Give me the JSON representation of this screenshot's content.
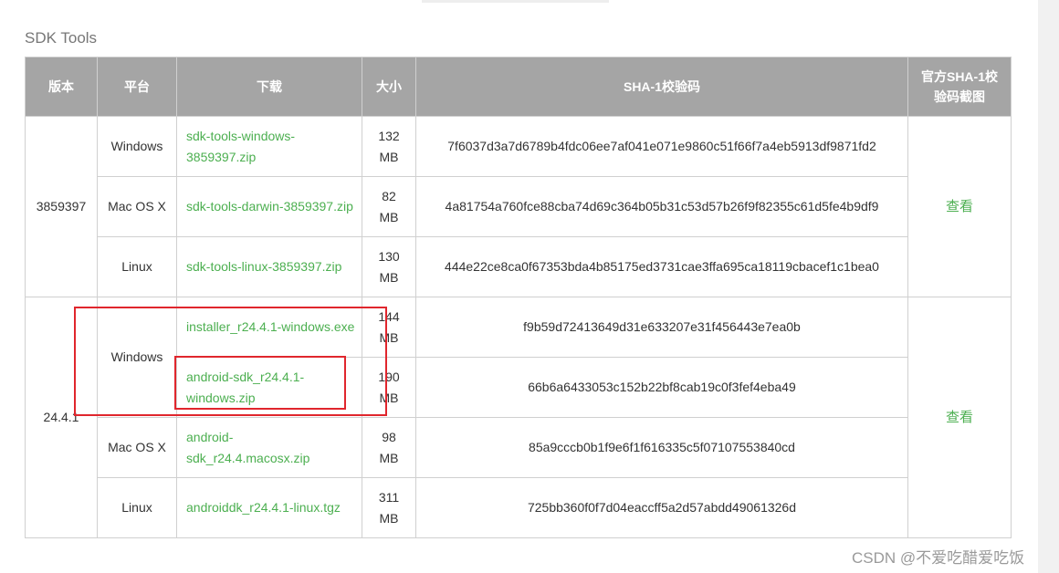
{
  "section_title": "SDK Tools",
  "headers": {
    "version": "版本",
    "platform": "平台",
    "download": "下载",
    "size": "大小",
    "sha1": "SHA-1校验码",
    "screenshot": "官方SHA-1校验码截图"
  },
  "groups": [
    {
      "version": "3859397",
      "view_label": "查看",
      "rows": [
        {
          "platform": "Windows",
          "file": "sdk-tools-windows-3859397.zip",
          "size": "132 MB",
          "sha1": "7f6037d3a7d6789b4fdc06ee7af041e071e9860c51f66f7a4eb5913df9871fd2"
        },
        {
          "platform": "Mac OS X",
          "file": "sdk-tools-darwin-3859397.zip",
          "size": "82 MB",
          "sha1": "4a81754a760fce88cba74d69c364b05b31c53d57b26f9f82355c61d5fe4b9df9"
        },
        {
          "platform": "Linux",
          "file": "sdk-tools-linux-3859397.zip",
          "size": "130 MB",
          "sha1": "444e22ce8ca0f67353bda4b85175ed3731cae3ffa695ca18119cbacef1c1bea0"
        }
      ]
    },
    {
      "version": "24.4.1",
      "view_label": "查看",
      "windows_platform": "Windows",
      "rows": [
        {
          "file": "installer_r24.4.1-windows.exe",
          "size": "144 MB",
          "sha1": "f9b59d72413649d31e633207e31f456443e7ea0b"
        },
        {
          "file": "android-sdk_r24.4.1-windows.zip",
          "size": "190 MB",
          "sha1": "66b6a6433053c152b22bf8cab19c0f3fef4eba49"
        },
        {
          "platform": "Mac OS X",
          "file": "android-sdk_r24.4.macosx.zip",
          "size": "98 MB",
          "sha1": "85a9cccb0b1f9e6f1f616335c5f07107553840cd"
        },
        {
          "platform": "Linux",
          "file": "androiddk_r24.4.1-linux.tgz",
          "size": "311 MB",
          "sha1": "725bb360f0f7d04eaccff5a2d57abdd49061326d"
        }
      ]
    }
  ],
  "annotation_color": "#e0262d",
  "link_color": "#4caf50",
  "header_color": "#a5a5a5",
  "watermark": "CSDN @不爱吃醋爱吃饭"
}
